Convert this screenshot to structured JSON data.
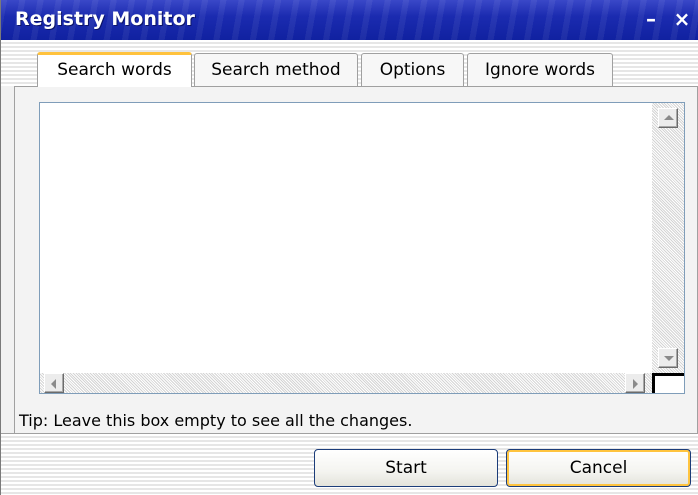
{
  "window": {
    "title": "Registry Monitor",
    "minimize_glyph": "–",
    "close_glyph": "×"
  },
  "tabs": [
    {
      "label": "Search words",
      "active": true
    },
    {
      "label": "Search method",
      "active": false
    },
    {
      "label": "Options",
      "active": false
    },
    {
      "label": "Ignore words",
      "active": false
    }
  ],
  "search_words": {
    "value": "",
    "tip": "Tip: Leave this box empty to see all the changes."
  },
  "buttons": {
    "start": "Start",
    "cancel": "Cancel"
  },
  "colors": {
    "titlebar": "#1b2bb0",
    "active_tab_accent": "#ffc23d",
    "focus_button_ring": "#ffc43f"
  }
}
